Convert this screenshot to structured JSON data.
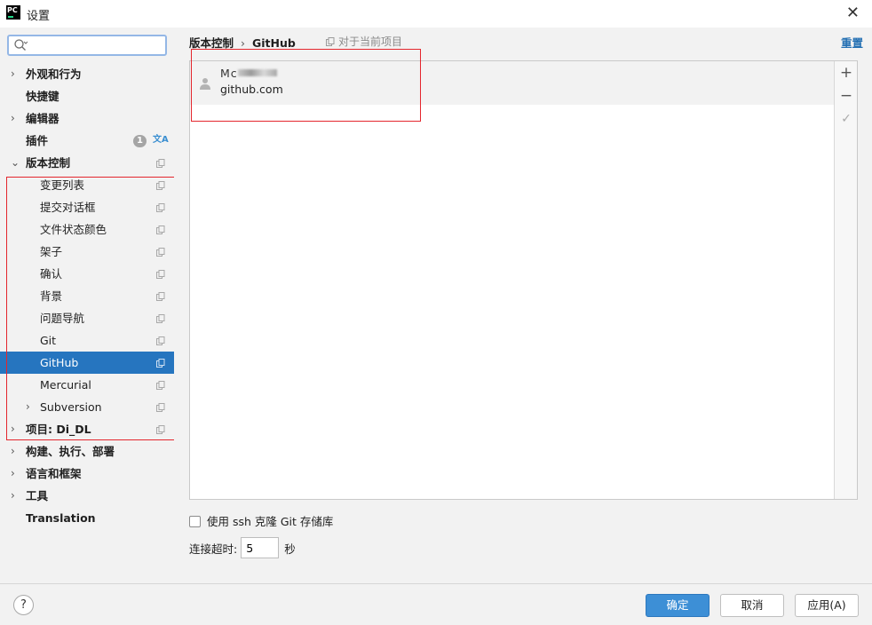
{
  "window": {
    "title": "设置",
    "logo_text": "PC"
  },
  "search": {
    "placeholder": ""
  },
  "sidebar": {
    "items": [
      {
        "label": "外观和行为",
        "arrow": "›",
        "bold": true
      },
      {
        "label": "快捷键",
        "bold": true
      },
      {
        "label": "编辑器",
        "arrow": "›",
        "bold": true
      },
      {
        "label": "插件",
        "bold": true,
        "badge": "1",
        "translate_icon": "文A"
      },
      {
        "label": "版本控制",
        "arrow": "⌄",
        "bold": true
      },
      {
        "label": "变更列表"
      },
      {
        "label": "提交对话框"
      },
      {
        "label": "文件状态颜色"
      },
      {
        "label": "架子"
      },
      {
        "label": "确认"
      },
      {
        "label": "背景"
      },
      {
        "label": "问题导航"
      },
      {
        "label": "Git"
      },
      {
        "label": "GitHub",
        "selected": true
      },
      {
        "label": "Mercurial"
      },
      {
        "label": "Subversion",
        "arrow": "›"
      },
      {
        "label": "项目: Di_DL",
        "arrow": "›",
        "bold": true
      },
      {
        "label": "构建、执行、部署",
        "arrow": "›",
        "bold": true
      },
      {
        "label": "语言和框架",
        "arrow": "›",
        "bold": true
      },
      {
        "label": "工具",
        "arrow": "›",
        "bold": true
      },
      {
        "label": "Translation",
        "bold": true
      }
    ]
  },
  "main": {
    "breadcrumb": {
      "parent": "版本控制",
      "separator": "›",
      "current": "GitHub"
    },
    "scope_label": "对于当前项目",
    "reset_label": "重置",
    "account": {
      "name_visible": "Mc",
      "server": "github.com"
    },
    "tools": {
      "add": "+",
      "remove": "−",
      "check": "✓"
    },
    "ssh_label": "使用 ssh 克隆 Git 存储库",
    "timeout": {
      "label": "连接超时:",
      "value": "5",
      "unit": "秒"
    }
  },
  "footer": {
    "help": "?",
    "ok": "确定",
    "cancel": "取消",
    "apply": "应用(A)"
  },
  "colors": {
    "selection": "#2675bf",
    "primary_button": "#3d8fd6",
    "link": "#2470b3",
    "highlight_box": "#e4262d"
  }
}
